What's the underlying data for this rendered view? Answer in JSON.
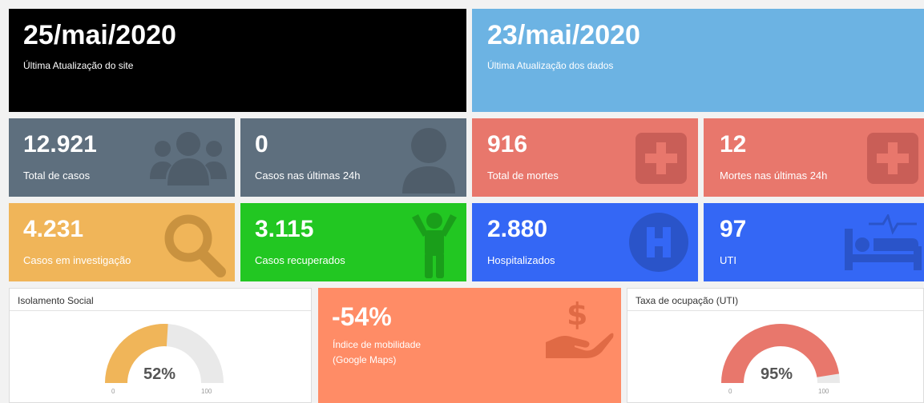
{
  "header": {
    "site_update": {
      "value": "25/mai/2020",
      "label": "Última Atualização do site",
      "bg": "#000000"
    },
    "data_update": {
      "value": "23/mai/2020",
      "label": "Última Atualização dos dados",
      "bg": "#6cb3e3"
    }
  },
  "stats": [
    {
      "value": "12.921",
      "label": "Total de casos",
      "icon": "group-icon",
      "bg": "#5e6f7e"
    },
    {
      "value": "0",
      "label": "Casos nas últimas 24h",
      "icon": "user-icon",
      "bg": "#5e6f7e"
    },
    {
      "value": "916",
      "label": "Total de mortes",
      "icon": "plus-square-icon",
      "bg": "#e8776c"
    },
    {
      "value": "12",
      "label": "Mortes nas últimas 24h",
      "icon": "plus-square-icon",
      "bg": "#e8776c"
    },
    {
      "value": "4.231",
      "label": "Casos em investigação",
      "icon": "search-icon",
      "bg": "#f0b559"
    },
    {
      "value": "3.115",
      "label": "Casos recuperados",
      "icon": "child-icon",
      "bg": "#22c722"
    },
    {
      "value": "2.880",
      "label": "Hospitalizados",
      "icon": "hospital-icon",
      "bg": "#3467f5"
    },
    {
      "value": "97",
      "label": "UTI",
      "icon": "bed-icon",
      "bg": "#3467f5"
    }
  ],
  "gauges": [
    {
      "title": "Isolamento Social",
      "value_label": "52%",
      "value": 52,
      "min": "0",
      "max": "100",
      "color": "#f0b559"
    },
    {
      "title": "Taxa de ocupação (UTI)",
      "value_label": "95%",
      "value": 95,
      "min": "0",
      "max": "100",
      "color": "#e8776c"
    }
  ],
  "mobility": {
    "value": "-54%",
    "label_line1": "Índice de mobilidade",
    "label_line2": "(Google Maps)",
    "icon": "hand-dollar-icon",
    "bg": "#ff8c66"
  }
}
